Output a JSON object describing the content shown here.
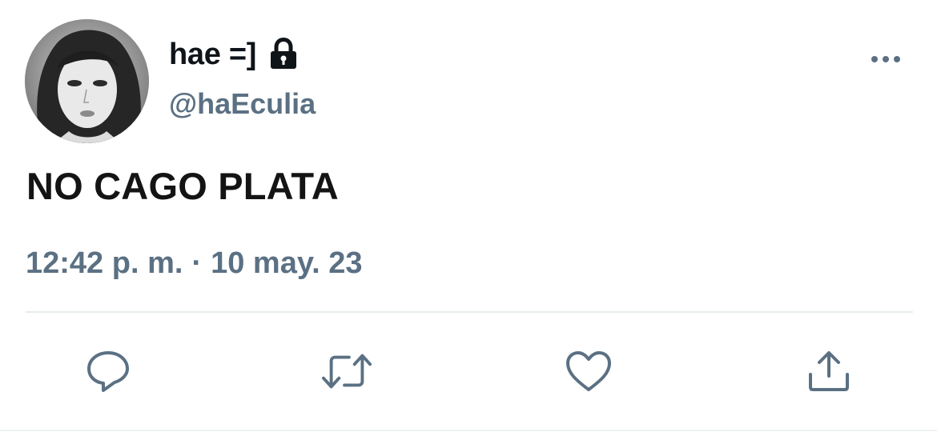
{
  "tweet": {
    "display_name": "hae =]",
    "handle": "@haEculia",
    "text": "NO CAGO PLATA",
    "time": "12:42 p. m.",
    "separator": "·",
    "date": "10 may. 23"
  },
  "icons": {
    "protected": "lock-icon",
    "more": "more-horizontal-icon",
    "reply": "reply-icon",
    "retweet": "retweet-icon",
    "like": "heart-icon",
    "share": "share-icon"
  },
  "colors": {
    "text_primary": "#0f1419",
    "text_secondary": "#5b7083",
    "divider": "#e6ecf0"
  }
}
